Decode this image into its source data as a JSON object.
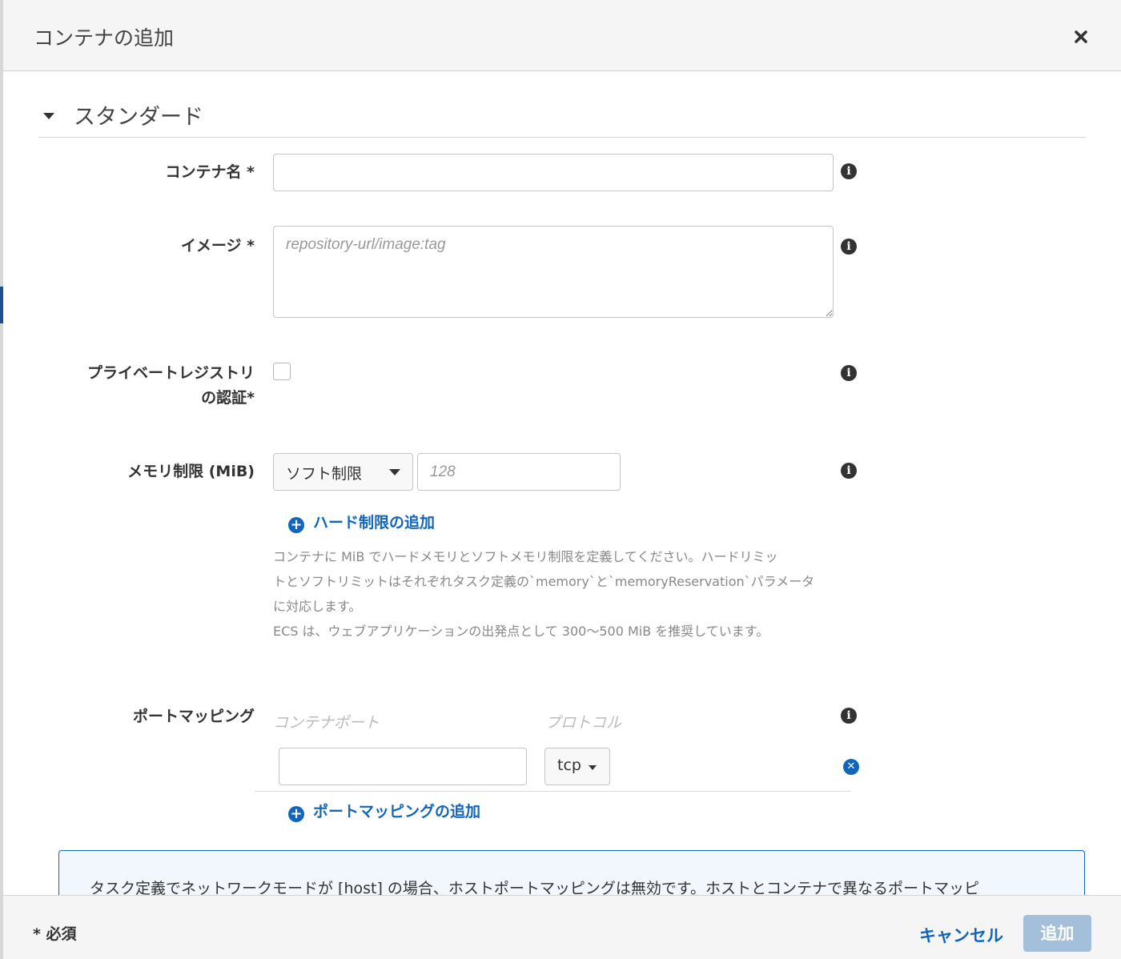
{
  "dialog": {
    "title": "コンテナの追加",
    "close_icon": "close-icon"
  },
  "section": {
    "label": "スタンダード",
    "caret_icon": "caret-down-icon"
  },
  "fields": {
    "container_name": {
      "label": "コンテナ名 *",
      "value": ""
    },
    "image": {
      "label": "イメージ *",
      "placeholder": "repository-url/image:tag",
      "value": ""
    },
    "private_registry": {
      "label_line1": "プライベートレジストリ",
      "label_line2": "の認証*",
      "checked": false
    },
    "memory": {
      "label": "メモリ制限 (MiB)",
      "limit_type": "ソフト制限",
      "placeholder": "128",
      "value": "",
      "add_hard_limit": "ハード制限の追加",
      "help_lines": [
        "コンテナに MiB でハードメモリとソフトメモリ制限を定義してください。ハードリミッ",
        "トとソフトリミットはそれぞれタスク定義の`memory`と`memoryReservation`パラメータ",
        "に対応します。",
        "ECS は、ウェブアプリケーションの出発点として 300〜500 MiB を推奨しています。"
      ]
    },
    "port_mapping": {
      "label": "ポートマッピング",
      "col_container_port": "コンテナポート",
      "col_protocol": "プロトコル",
      "rows": [
        {
          "container_port": "",
          "protocol": "tcp"
        }
      ],
      "add_link": "ポートマッピングの追加"
    }
  },
  "notice": {
    "text": "タスク定義でネットワークモードが [host] の場合、ホストポートマッピングは無効です。ホストとコンテナで異なるポートマッピ"
  },
  "footer": {
    "required_note": "* 必須",
    "cancel_label": "キャンセル",
    "add_label": "追加"
  },
  "colors": {
    "link": "#1166bb",
    "primary_disabled": "#a3bfd9",
    "header_bg": "#f5f5f5"
  }
}
